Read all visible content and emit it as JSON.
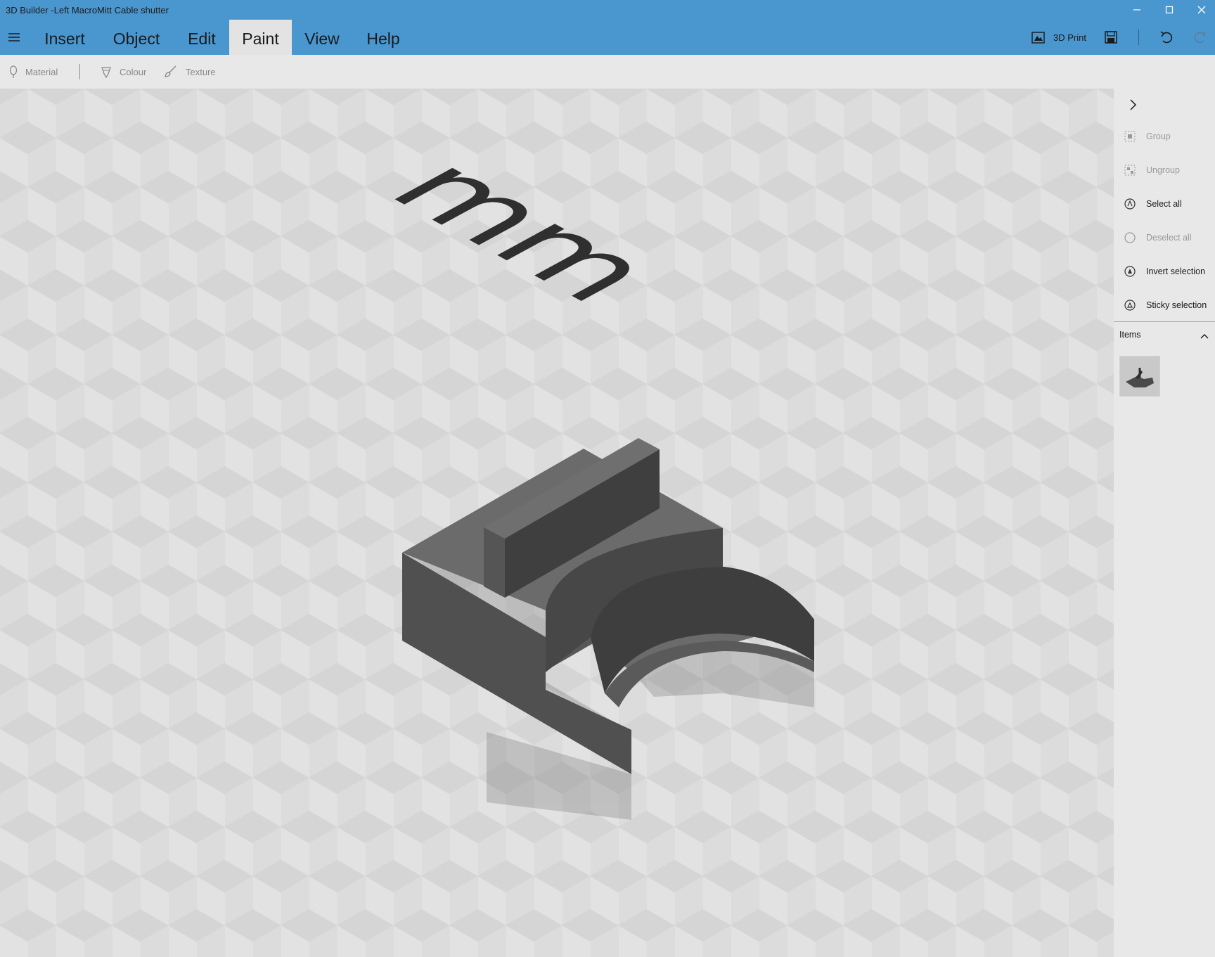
{
  "window": {
    "title": "3D Builder -Left MacroMitt Cable shutter",
    "controls": [
      "minimize-icon",
      "maximize-icon",
      "close-icon"
    ]
  },
  "menu": {
    "tabs": [
      {
        "label": "Insert"
      },
      {
        "label": "Object"
      },
      {
        "label": "Edit"
      },
      {
        "label": "Paint",
        "active": true
      },
      {
        "label": "View"
      },
      {
        "label": "Help"
      }
    ],
    "print_label": "3D Print"
  },
  "toolbar": {
    "material_label": "Material",
    "colour_label": "Colour",
    "texture_label": "Texture"
  },
  "viewport": {
    "units_label": "mm"
  },
  "panel": {
    "actions": [
      {
        "label": "Group",
        "enabled": false,
        "icon": "group-icon"
      },
      {
        "label": "Ungroup",
        "enabled": false,
        "icon": "ungroup-icon"
      },
      {
        "label": "Select all",
        "enabled": true,
        "icon": "select-all-icon"
      },
      {
        "label": "Deselect all",
        "enabled": false,
        "icon": "deselect-all-icon"
      },
      {
        "label": "Invert selection",
        "enabled": true,
        "icon": "invert-selection-icon"
      },
      {
        "label": "Sticky selection",
        "enabled": true,
        "icon": "sticky-selection-icon"
      }
    ],
    "items_label": "Items"
  },
  "colors": {
    "accent": "#4a97d0",
    "model": "#5a5a5a",
    "panel_bg": "#e8e8e8"
  }
}
